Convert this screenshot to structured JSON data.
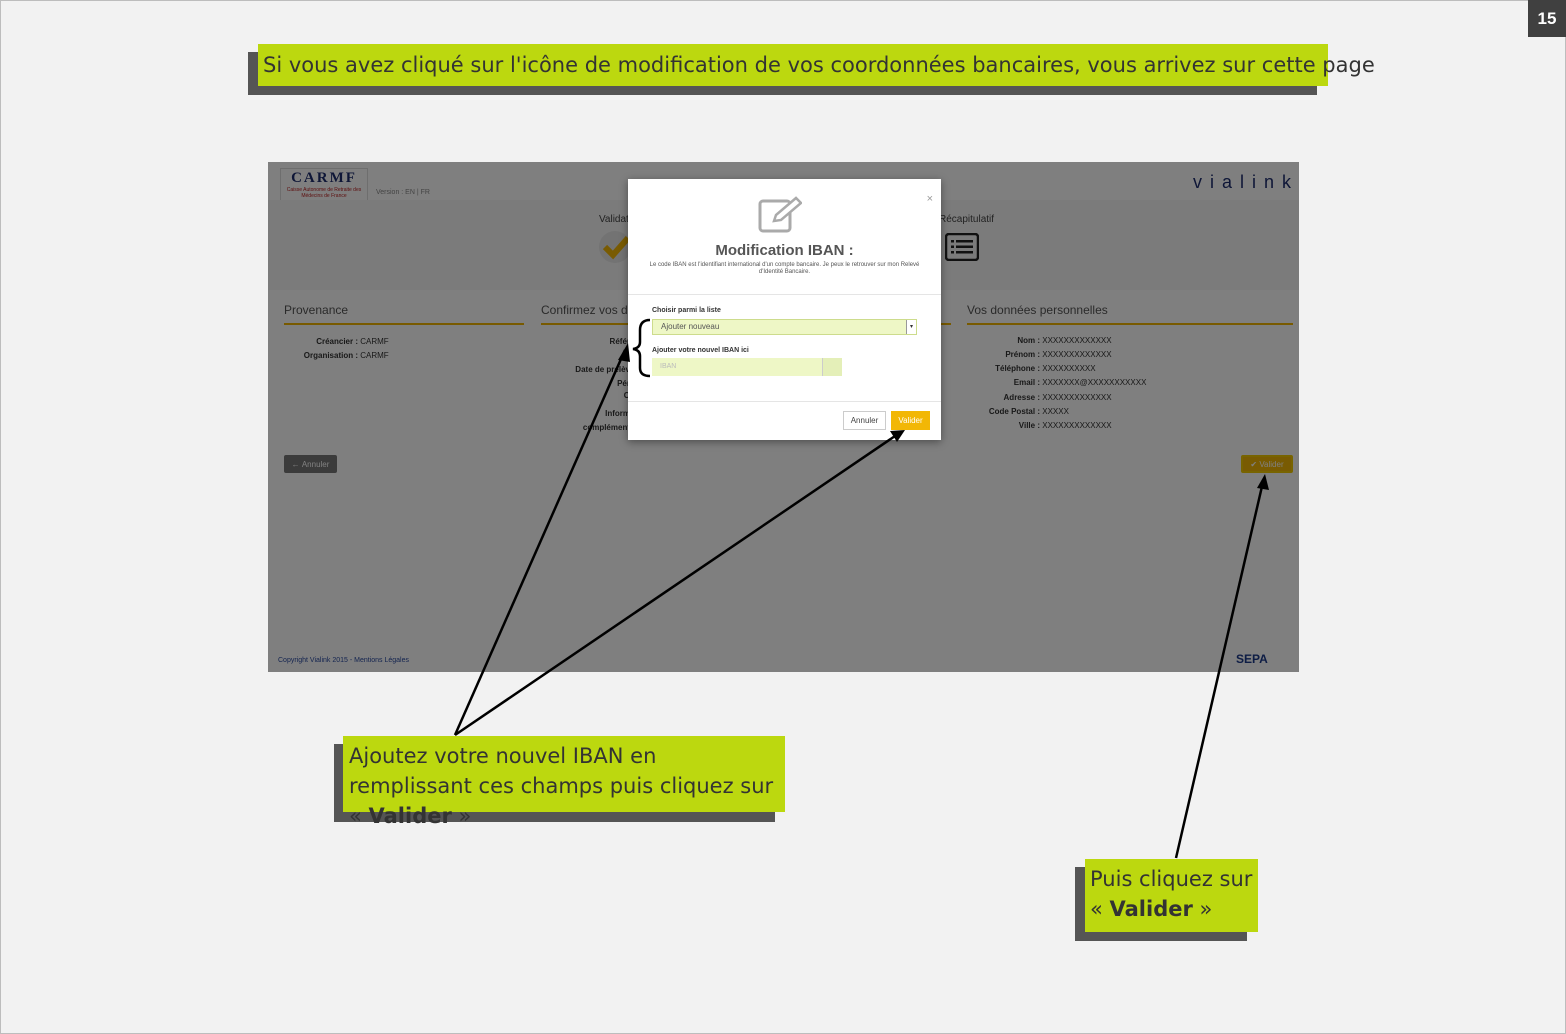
{
  "slide": {
    "page_number": "15",
    "title_callout": "Si vous avez cliqué sur l'icône de modification de vos coordonnées bancaires, vous arrivez sur cette page",
    "callout_left": {
      "text_before": "Ajoutez votre nouvel IBAN en remplissant ces champs puis cliquez sur « ",
      "bold": "Valider",
      "text_after": " »"
    },
    "callout_right": {
      "text_before": "Puis cliquez sur « ",
      "bold": "Valider",
      "text_after": " »"
    },
    "colors": {
      "callout_bg": "#bcd80f",
      "accent": "#f2b705",
      "shadow": "#555555"
    }
  },
  "app": {
    "logo_text": "CARMF",
    "logo_subtitle": "Caisse Autonome de Retraite des Médecins de France",
    "version": "Version : EN | FR",
    "brand": "vialink",
    "steps": [
      "Validat",
      "Récapitulatif"
    ],
    "panels": {
      "provenance": {
        "title": "Provenance",
        "rows": [
          {
            "key": "Créancier :",
            "value": "CARMF"
          },
          {
            "key": "Organisation :",
            "value": "CARMF"
          }
        ]
      },
      "confirmez": {
        "title": "Confirmez vos do",
        "keys": [
          "Référ",
          "Id",
          "Date de prélèv",
          "Pér",
          "O",
          "Inform",
          "complément"
        ]
      },
      "personnelles": {
        "title": "Vos données personnelles",
        "rows": [
          {
            "key": "Nom :",
            "value": "XXXXXXXXXXXXX"
          },
          {
            "key": "Prénom :",
            "value": "XXXXXXXXXXXXX"
          },
          {
            "key": "Téléphone :",
            "value": "XXXXXXXXXX"
          },
          {
            "key": "Email :",
            "value": "XXXXXXX@XXXXXXXXXXX"
          },
          {
            "key": "Adresse :",
            "value": "XXXXXXXXXXXXX"
          },
          {
            "key": "Code Postal :",
            "value": "XXXXX"
          },
          {
            "key": "Ville :",
            "value": "XXXXXXXXXXXXX"
          }
        ]
      }
    },
    "annuler_label": "Annuler",
    "valider_label": "Valider",
    "footer": "Copyright Vialink 2015 - Mentions Légales",
    "sepa": "SEPA"
  },
  "modal": {
    "close": "×",
    "title": "Modification IBAN :",
    "description": "Le code IBAN est l'identifiant international d'un compte bancaire. Je peux le retrouver sur mon Relevé d'Identité Bancaire.",
    "select_label": "Choisir parmi la liste",
    "select_value": "Ajouter nouveau",
    "iban_label": "Ajouter votre nouvel IBAN ici",
    "iban_placeholder": "IBAN",
    "annuler": "Annuler",
    "valider": "Valider"
  }
}
